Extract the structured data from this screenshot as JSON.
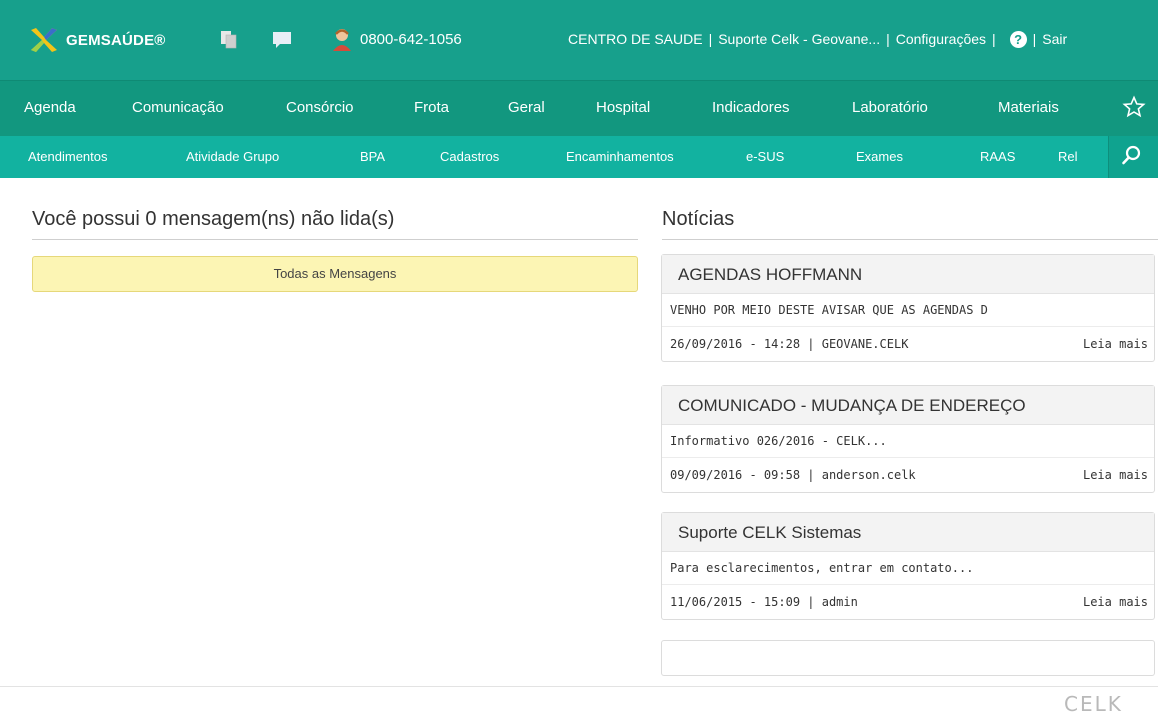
{
  "topbar": {
    "brand": "GEMSAÚDE®",
    "phone": "0800-642-1056",
    "links": [
      "CENTRO DE SAUDE",
      "Suporte Celk - Geovane...",
      "Configurações"
    ],
    "help": "?",
    "exit": "Sair",
    "colors": {
      "bar": "#17a08c"
    }
  },
  "menu1": {
    "items": [
      "Agenda",
      "Comunicação",
      "Consórcio",
      "Frota",
      "Geral",
      "Hospital",
      "Indicadores",
      "Laboratório",
      "Materiais"
    ]
  },
  "menu2": {
    "items": [
      "Atendimentos",
      "Atividade Grupo",
      "BPA",
      "Cadastros",
      "Encaminhamentos",
      "e-SUS",
      "Exames",
      "RAAS",
      "Rel"
    ]
  },
  "messages": {
    "title": "Você possui 0 mensagem(ns) não lida(s)",
    "all_button": "Todas as Mensagens"
  },
  "news": {
    "title": "Notícias",
    "items": [
      {
        "title": "AGENDAS HOFFMANN",
        "summary": "VENHO POR MEIO DESTE AVISAR QUE AS AGENDAS D",
        "meta": "26/09/2016 - 14:28 | GEOVANE.CELK",
        "more": "Leia mais"
      },
      {
        "title": "COMUNICADO - MUDANÇA DE ENDEREÇO",
        "summary": "Informativo 026/2016 - CELK...",
        "meta": "09/09/2016 - 09:58 | anderson.celk",
        "more": "Leia mais"
      },
      {
        "title": "Suporte CELK Sistemas",
        "summary": "Para esclarecimentos, entrar em contato...",
        "meta": "11/06/2015 - 15:09 | admin",
        "more": "Leia mais"
      }
    ]
  },
  "footer": {
    "logo": "CELK"
  }
}
